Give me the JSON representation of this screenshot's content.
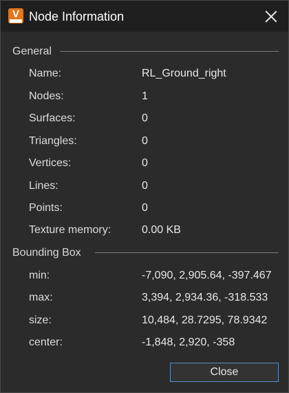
{
  "window": {
    "title": "Node Information",
    "app_icon_letter": "V",
    "app_icon_name": "vred-pro-app-icon",
    "close_icon_name": "close-icon"
  },
  "general": {
    "header": "General",
    "rows": [
      {
        "label": "Name:",
        "value": "RL_Ground_right"
      },
      {
        "label": "Nodes:",
        "value": "1"
      },
      {
        "label": "Surfaces:",
        "value": "0"
      },
      {
        "label": "Triangles:",
        "value": "0"
      },
      {
        "label": "Vertices:",
        "value": "0"
      },
      {
        "label": "Lines:",
        "value": "0"
      },
      {
        "label": "Points:",
        "value": "0"
      },
      {
        "label": "Texture memory:",
        "value": "0.00 KB"
      }
    ]
  },
  "bounding_box": {
    "header": "Bounding Box",
    "rows": [
      {
        "label": "min:",
        "value": "-7,090, 2,905.64, -397.467"
      },
      {
        "label": "max:",
        "value": "3,394, 2,934.36, -318.533"
      },
      {
        "label": "size:",
        "value": "10,484, 28.7295, 78.9342"
      },
      {
        "label": "center:",
        "value": "-1,848, 2,920, -358"
      }
    ]
  },
  "buttons": {
    "close_label": "Close"
  },
  "colors": {
    "background": "#2b2b2b",
    "titlebar": "#1f1f1f",
    "icon_orange": "#e2761b",
    "button_border": "#5a8fc4"
  }
}
